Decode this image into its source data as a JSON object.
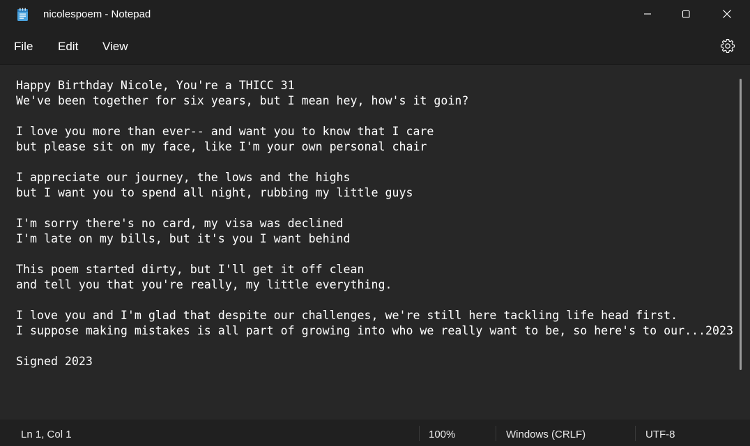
{
  "window": {
    "title": "nicolespoem - Notepad",
    "icon": "notepad-icon"
  },
  "controls": {
    "minimize": "minimize-icon",
    "maximize": "maximize-icon",
    "close": "close-icon"
  },
  "menu": {
    "file": "File",
    "edit": "Edit",
    "view": "View",
    "settings_icon": "gear-icon"
  },
  "editor": {
    "content": "Happy Birthday Nicole, You're a THICC 31\nWe've been together for six years, but I mean hey, how's it goin?\n\nI love you more than ever-- and want you to know that I care\nbut please sit on my face, like I'm your own personal chair\n\nI appreciate our journey, the lows and the highs\nbut I want you to spend all night, rubbing my little guys\n\nI'm sorry there's no card, my visa was declined\nI'm late on my bills, but it's you I want behind\n\nThis poem started dirty, but I'll get it off clean\nand tell you that you're really, my little everything.\n\nI love you and I'm glad that despite our challenges, we're still here tackling life head first.\nI suppose making mistakes is all part of growing into who we really want to be, so here's to our...2023\n\nSigned 2023"
  },
  "status": {
    "position": "Ln 1, Col 1",
    "zoom": "100%",
    "line_ending": "Windows (CRLF)",
    "encoding": "UTF-8"
  },
  "colors": {
    "titlebar_bg": "#202020",
    "editor_bg": "#272727",
    "text": "#ffffff",
    "icon_accent": "#4aa3df"
  }
}
